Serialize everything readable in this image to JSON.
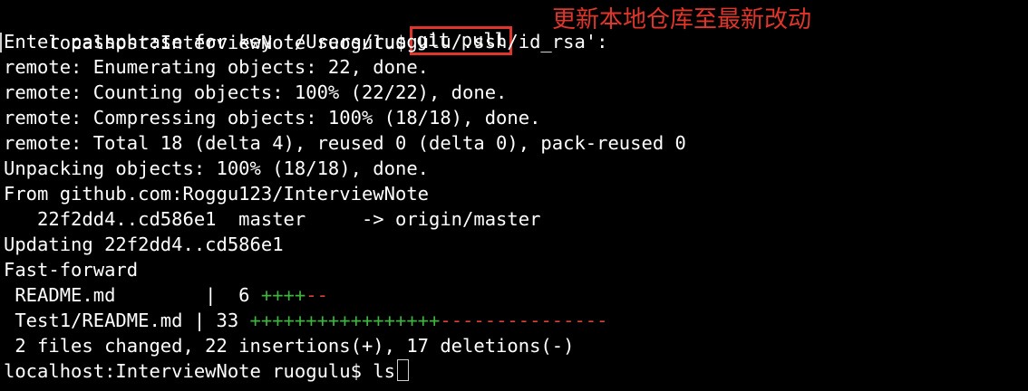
{
  "terminal": {
    "prompt": "localhost:InterviewNote ruogulu$",
    "command": "git pull",
    "annotation": "更新本地仓库至最新改动",
    "lines": [
      "Enter passphrase for key '/Users/ruogulu/.ssh/id_rsa':",
      "remote: Enumerating objects: 22, done.",
      "remote: Counting objects: 100% (22/22), done.",
      "remote: Compressing objects: 100% (18/18), done.",
      "remote: Total 18 (delta 4), reused 0 (delta 0), pack-reused 0",
      "Unpacking objects: 100% (18/18), done.",
      "From github.com:Roggu123/InterviewNote",
      "   22f2dd4..cd586e1  master     -> origin/master",
      "Updating 22f2dd4..cd586e1",
      "Fast-forward"
    ],
    "diffstat": [
      {
        "file": " README.md        |  6 ",
        "plus": "++++",
        "minus": "--"
      },
      {
        "file": " Test1/README.md | 33 ",
        "plus": "+++++++++++++++++",
        "minus": "---------------"
      }
    ],
    "summary": " 2 files changed, 22 insertions(+), 17 deletions(-)",
    "last_prompt": "localhost:InterviewNote ruogulu$",
    "last_command": " ls"
  },
  "colors": {
    "background": "#000000",
    "text": "#ffffff",
    "annotation": "#e0352b",
    "plus": "#3fb23f",
    "minus": "#d9413a"
  }
}
